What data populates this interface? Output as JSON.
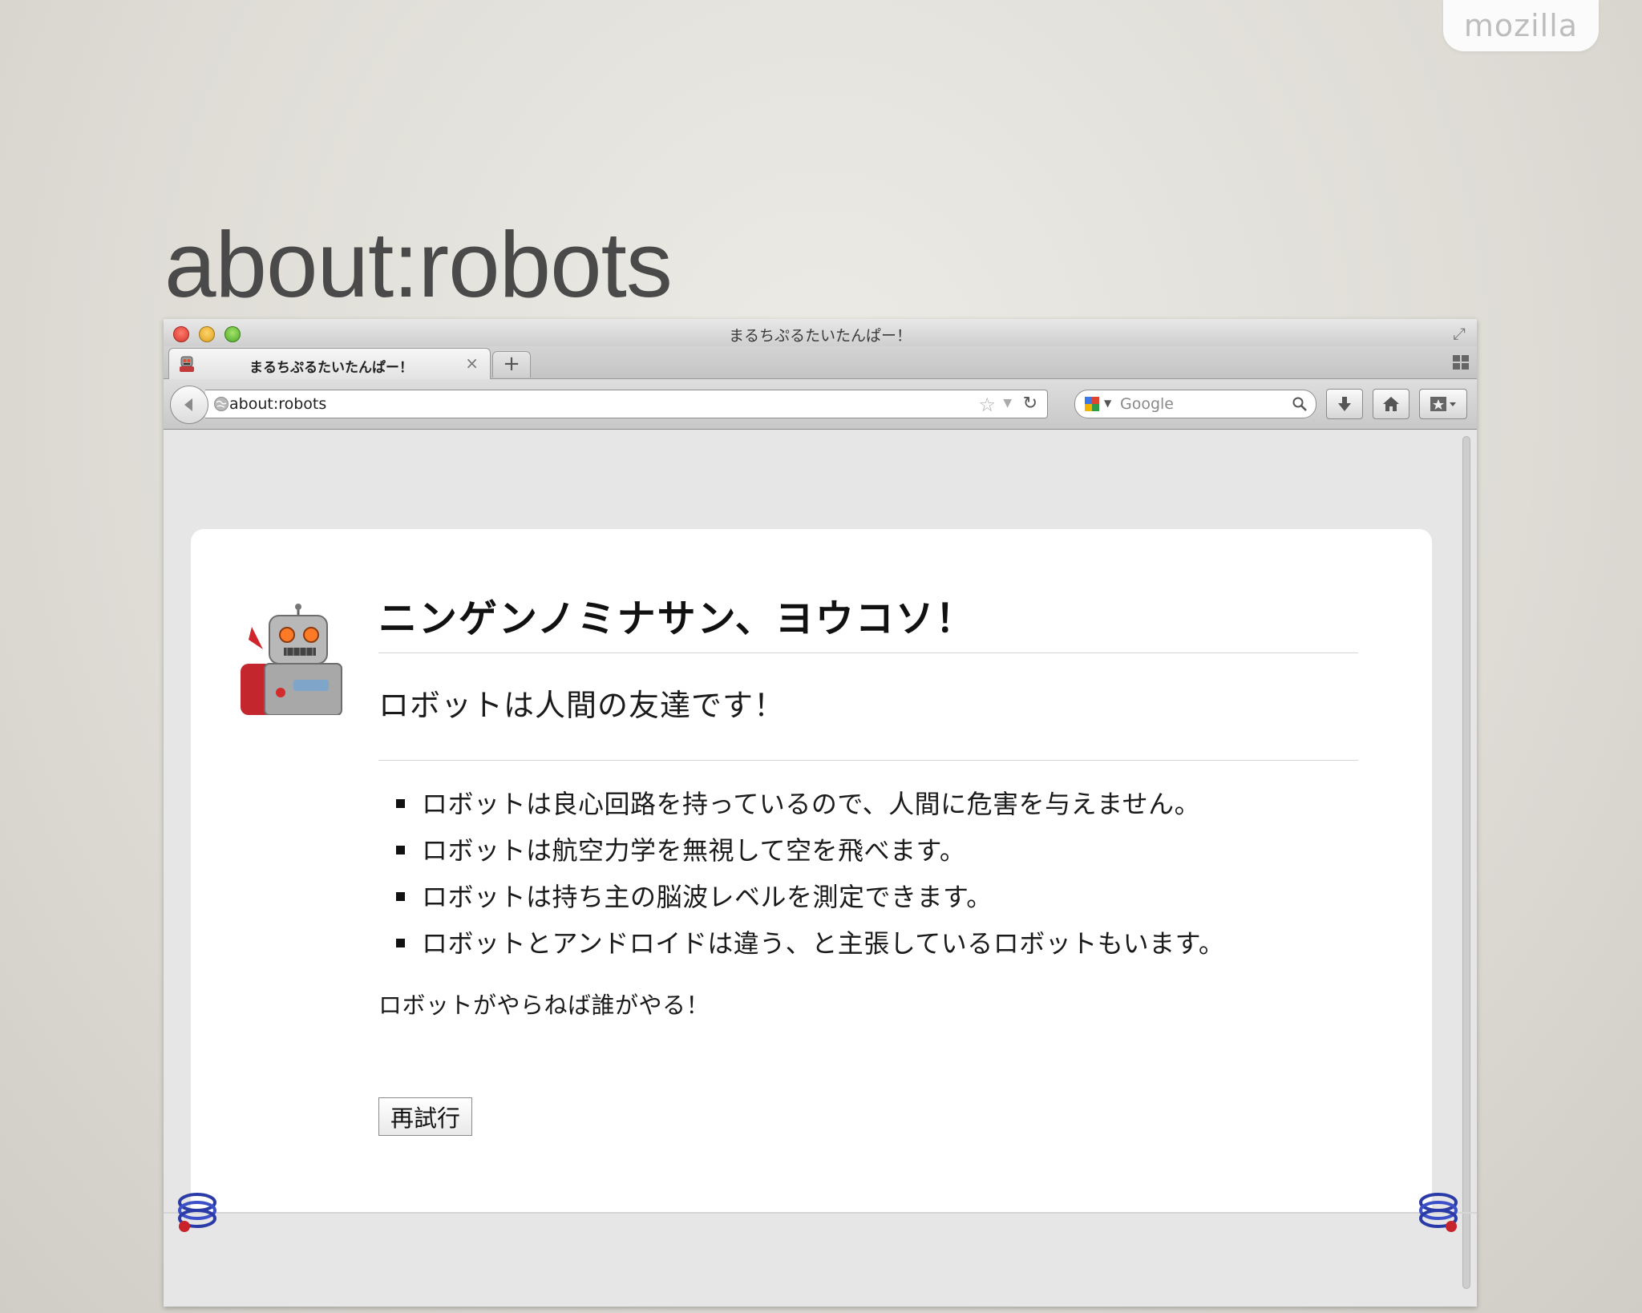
{
  "slide": {
    "brand": "mozilla",
    "title": "about:robots"
  },
  "window": {
    "title": "まるちぷるたいたんぱー！"
  },
  "tab": {
    "label": "まるちぷるたいたんぱー！",
    "close": "×",
    "new_tab": "+"
  },
  "navbar": {
    "url": "about:robots",
    "search_placeholder": "Google"
  },
  "page": {
    "heading": "ニンゲンノミナサン、ヨウコソ！",
    "subheading": "ロボットは人間の友達です！",
    "facts": [
      "ロボットは良心回路を持っているので、人間に危害を与えません。",
      "ロボットは航空力学を無視して空を飛べます。",
      "ロボットは持ち主の脳波レベルを測定できます。",
      "ロボットとアンドロイドは違う、と主張しているロボットもいます。"
    ],
    "tagline": "ロボットがやらねば誰がやる！",
    "retry_button": "再試行"
  },
  "colors": {
    "background": "#e3e1da",
    "card": "#ffffff",
    "content_bg": "#e6e6e6"
  }
}
